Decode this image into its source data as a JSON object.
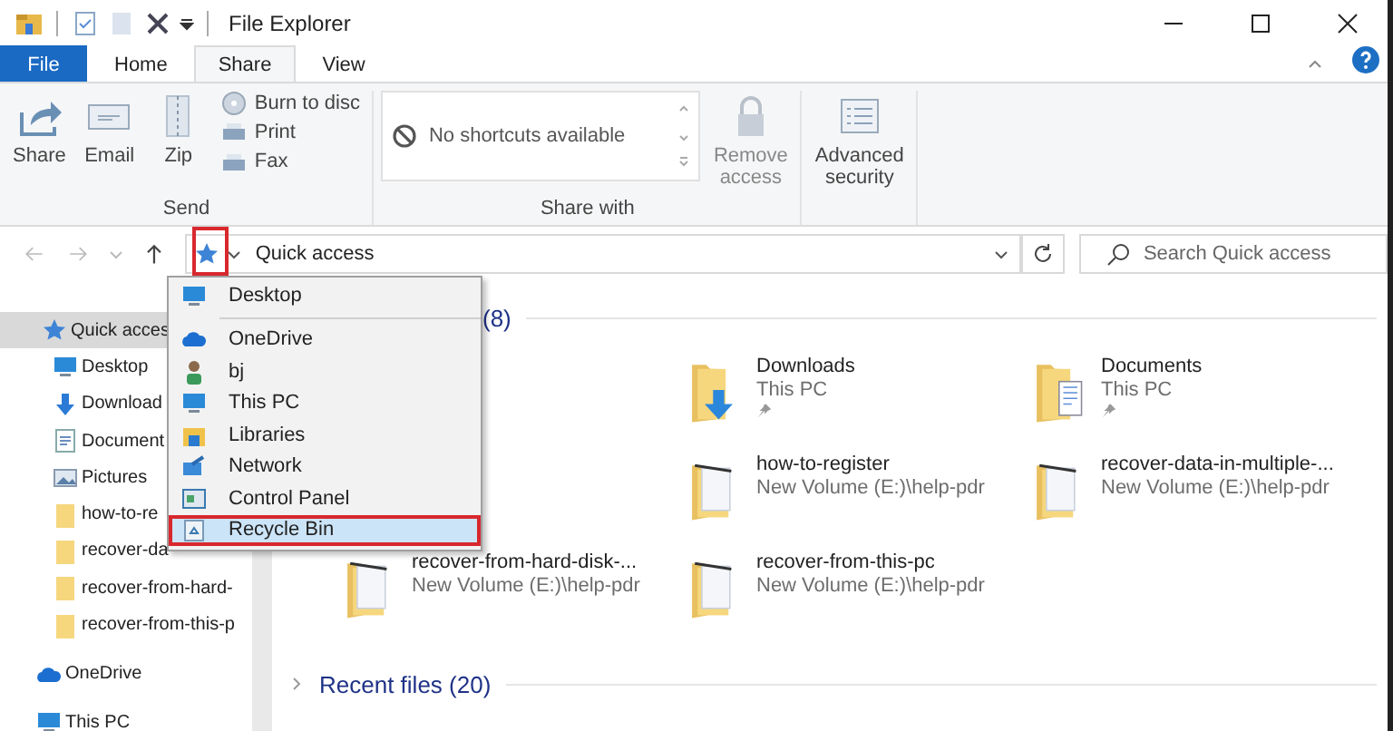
{
  "title_bar": {
    "title": "File Explorer"
  },
  "ribbon_tabs": [
    {
      "label": "File",
      "kind": "file",
      "selected": false
    },
    {
      "label": "Home",
      "kind": "tab",
      "selected": false
    },
    {
      "label": "Share",
      "kind": "tab",
      "selected": true
    },
    {
      "label": "View",
      "kind": "tab",
      "selected": false
    }
  ],
  "send_group": {
    "label": "Send",
    "large_buttons": [
      {
        "label": "Share",
        "kind": "share"
      },
      {
        "label": "Email",
        "kind": "email"
      },
      {
        "label": "Zip",
        "kind": "zip"
      }
    ],
    "small_buttons": [
      {
        "label": "Burn to disc",
        "kind": "disc"
      },
      {
        "label": "Print",
        "kind": "print"
      },
      {
        "label": "Fax",
        "kind": "fax"
      }
    ]
  },
  "share_with_group": {
    "label": "Share with",
    "list_text": "No shortcuts available",
    "remove_access": {
      "lines": [
        "Remove",
        "access"
      ],
      "disabled": true
    }
  },
  "advanced_security": {
    "lines": [
      "Advanced",
      "security"
    ]
  },
  "address_bar": {
    "location": "Quick access"
  },
  "search": {
    "placeholder": "Search Quick access"
  },
  "sidebar": [
    {
      "label": "Quick acces",
      "kind": "star",
      "selected": true
    },
    {
      "label": "Desktop",
      "kind": "desktop",
      "selected": false
    },
    {
      "label": "Download",
      "kind": "download",
      "selected": false
    },
    {
      "label": "Document",
      "kind": "document",
      "selected": false
    },
    {
      "label": "Pictures",
      "kind": "pictures",
      "selected": false
    },
    {
      "label": "how-to-re",
      "kind": "folder",
      "selected": false
    },
    {
      "label": "recover-da",
      "kind": "folder",
      "selected": false
    },
    {
      "label": "recover-from-hard-",
      "kind": "folder",
      "selected": false
    },
    {
      "label": "recover-from-this-p",
      "kind": "folder",
      "selected": false
    },
    {
      "label": "OneDrive",
      "kind": "onedrive",
      "selected": false
    },
    {
      "label": "This PC",
      "kind": "pc",
      "selected": false
    }
  ],
  "content": {
    "frequent_heading": "(8)",
    "tiles": [
      {
        "name": "Downloads",
        "location": "This PC",
        "pinned": true,
        "kind": "download"
      },
      {
        "name": "Documents",
        "location": "This PC",
        "pinned": true,
        "kind": "document"
      },
      {
        "name": "how-to-register",
        "location": "New Volume (E:)\\help-pdr",
        "pinned": false,
        "kind": "folder"
      },
      {
        "name": "recover-data-in-multiple-...",
        "location": "New Volume (E:)\\help-pdr",
        "pinned": false,
        "kind": "folder"
      },
      {
        "name": "recover-from-hard-disk-...",
        "location": "New Volume (E:)\\help-pdr",
        "pinned": false,
        "kind": "folder"
      },
      {
        "name": "recover-from-this-pc",
        "location": "New Volume (E:)\\help-pdr",
        "pinned": false,
        "kind": "folder"
      }
    ],
    "recent_heading": "Recent files (20)"
  },
  "location_menu": {
    "items": [
      {
        "label": "Desktop",
        "kind": "desktop",
        "selected": false
      },
      {
        "label": "OneDrive",
        "kind": "onedrive",
        "selected": false
      },
      {
        "label": "bj",
        "kind": "user",
        "selected": false
      },
      {
        "label": "This PC",
        "kind": "pc",
        "selected": false
      },
      {
        "label": "Libraries",
        "kind": "libraries",
        "selected": false
      },
      {
        "label": "Network",
        "kind": "network",
        "selected": false
      },
      {
        "label": "Control Panel",
        "kind": "control",
        "selected": false
      },
      {
        "label": "Recycle Bin",
        "kind": "recycle",
        "selected": true
      }
    ]
  }
}
